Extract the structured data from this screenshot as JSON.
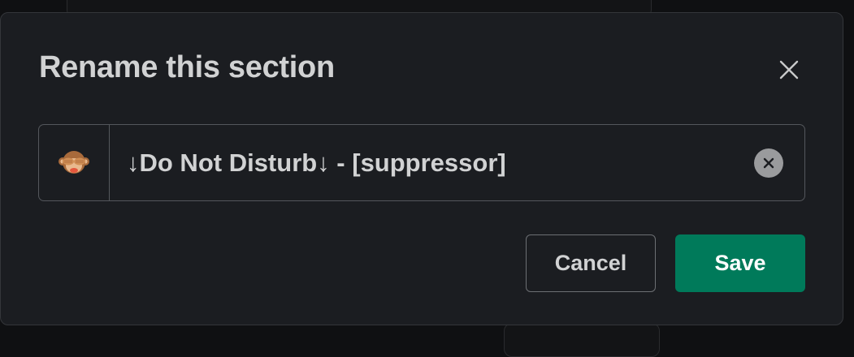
{
  "dialog": {
    "title": "Rename this section",
    "close_icon": "close-icon"
  },
  "section_name": {
    "emoji": "see-no-evil-monkey",
    "value": "↓Do Not Disturb↓ - [suppressor]",
    "clear_icon": "clear-circle-x-icon"
  },
  "actions": {
    "cancel_label": "Cancel",
    "save_label": "Save"
  },
  "colors": {
    "modal_bg": "#1b1d21",
    "text": "#d1d2d3",
    "save_bg": "#007a5a",
    "border": "#54575c"
  }
}
